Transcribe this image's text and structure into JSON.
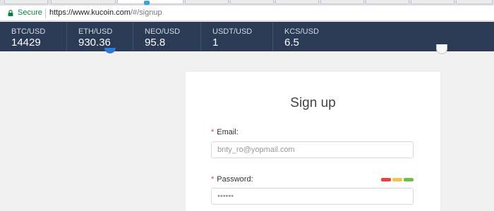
{
  "browser": {
    "secure_label": "Secure",
    "url_host": "https://www.kucoin.com",
    "url_path": "/#/signup"
  },
  "ticker": [
    {
      "pair": "BTC/USD",
      "price": "14429"
    },
    {
      "pair": "ETH/USD",
      "price": "930.36"
    },
    {
      "pair": "NEO/USD",
      "price": "95.8"
    },
    {
      "pair": "USDT/USD",
      "price": "1"
    },
    {
      "pair": "KCS/USD",
      "price": "6.5"
    }
  ],
  "signup": {
    "title": "Sign up",
    "required_mark": "*",
    "email_label": "Email:",
    "email_value": "bnty_ro@yopmail.com",
    "password_label": "Password:",
    "password_value": "••••••",
    "strength_colors": [
      "#e0463b",
      "#f0c74a",
      "#6cc04a"
    ]
  },
  "colors": {
    "ticker_bg": "#2b3a55",
    "secure_green": "#0b8043"
  }
}
